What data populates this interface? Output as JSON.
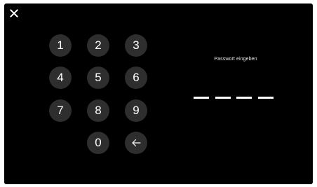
{
  "prompt": {
    "label": "Passwort eingeben"
  },
  "keypad": {
    "keys": [
      "1",
      "2",
      "3",
      "4",
      "5",
      "6",
      "7",
      "8",
      "9",
      "0"
    ],
    "backspace_icon": "arrow-left-icon"
  },
  "close": {
    "icon": "close-icon"
  },
  "pin": {
    "length": 4,
    "entered": 0
  },
  "colors": {
    "background": "#000000",
    "key_background": "#2e2e2e",
    "text": "#ffffff"
  }
}
